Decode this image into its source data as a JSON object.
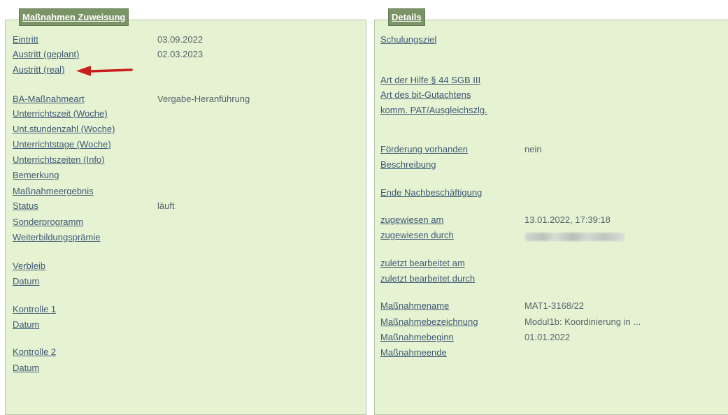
{
  "left_panel": {
    "title": "Maßnahmen Zuweisung",
    "rows": [
      {
        "label": "Eintritt",
        "value": "03.09.2022"
      },
      {
        "label": "Austritt (geplant)",
        "value": "02.03.2023"
      },
      {
        "label": "Austritt (real)",
        "value": ""
      },
      {
        "label": "BA-Maßnahmeart",
        "value": "Vergabe-Heranführung"
      },
      {
        "label": "Unterrichtszeit (Woche)",
        "value": ""
      },
      {
        "label": "Unt.stundenzahl (Woche)",
        "value": ""
      },
      {
        "label": "Unterrichtstage (Woche)",
        "value": ""
      },
      {
        "label": "Unterrichtszeiten (Info)",
        "value": ""
      },
      {
        "label": "Bemerkung",
        "value": ""
      },
      {
        "label": "Maßnahmeergebnis",
        "value": ""
      },
      {
        "label": "Status",
        "value": "läuft"
      },
      {
        "label": "Sonderprogramm",
        "value": ""
      },
      {
        "label": "Weiterbildungsprämie",
        "value": ""
      },
      {
        "label": "Verbleib",
        "value": ""
      },
      {
        "label": "Datum",
        "value": ""
      },
      {
        "label": "Kontrolle 1",
        "value": ""
      },
      {
        "label": "Datum",
        "value": ""
      },
      {
        "label": "Kontrolle 2",
        "value": ""
      },
      {
        "label": "Datum",
        "value": ""
      }
    ]
  },
  "right_panel": {
    "title": "Details",
    "rows": [
      {
        "label": "Schulungsziel",
        "value": ""
      },
      {
        "label": "Art der Hilfe § 44 SGB III",
        "value": ""
      },
      {
        "label": "Art des bit-Gutachtens",
        "value": ""
      },
      {
        "label": "komm. PAT/Ausgleichszlg.",
        "value": ""
      },
      {
        "label": "Förderung vorhanden",
        "value": "nein"
      },
      {
        "label": "Beschreibung",
        "value": ""
      },
      {
        "label": "Ende Nachbeschäftigung",
        "value": ""
      },
      {
        "label": "zugewiesen am",
        "value": "13.01.2022, 17:39:18"
      },
      {
        "label": "zugewiesen durch",
        "value": ""
      },
      {
        "label": "zuletzt bearbeitet am",
        "value": ""
      },
      {
        "label": "zuletzt bearbeitet durch",
        "value": ""
      },
      {
        "label": "Maßnahmename",
        "value": "MAT1-3168/22"
      },
      {
        "label": "Maßnahmebezeichnung",
        "value": "Modul1b: Koordinierung in ..."
      },
      {
        "label": "Maßnahmebeginn",
        "value": "01.01.2022"
      },
      {
        "label": "Maßnahmeende",
        "value": ""
      }
    ]
  },
  "annotation": {
    "color": "#c8201a"
  }
}
